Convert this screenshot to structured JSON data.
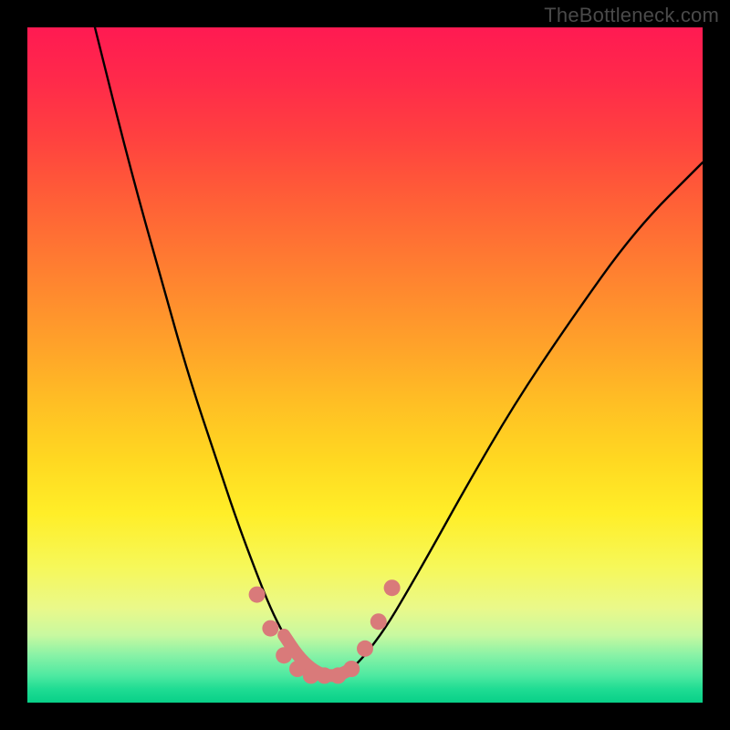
{
  "watermark": "TheBottleneck.com",
  "chart_data": {
    "type": "line",
    "title": "",
    "xlabel": "",
    "ylabel": "",
    "xlim": [
      0,
      100
    ],
    "ylim": [
      0,
      100
    ],
    "series": [
      {
        "name": "curve",
        "x": [
          10,
          15,
          20,
          24,
          28,
          31,
          34,
          36,
          38,
          40,
          42,
          44,
          46,
          48,
          50,
          53,
          56,
          60,
          65,
          72,
          80,
          90,
          100
        ],
        "values": [
          100,
          80,
          62,
          48,
          36,
          27,
          19,
          14,
          10,
          7,
          5,
          4,
          4,
          5,
          7,
          11,
          16,
          23,
          32,
          44,
          56,
          70,
          80
        ]
      }
    ],
    "markers": {
      "name": "highlight-dots",
      "color": "#d97a7a",
      "x": [
        34,
        36,
        38,
        40,
        42,
        44,
        46,
        48,
        50,
        52,
        54
      ],
      "values": [
        16,
        11,
        7,
        5,
        4,
        4,
        4,
        5,
        8,
        12,
        17
      ]
    }
  }
}
